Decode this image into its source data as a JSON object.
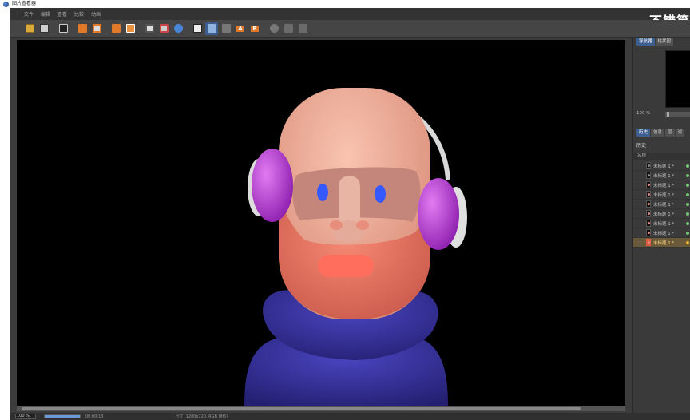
{
  "window": {
    "title": "图片查看器"
  },
  "menubar": {
    "items": [
      "文件",
      "编辑",
      "查看",
      "比较",
      "动画"
    ],
    "banner": "不错算"
  },
  "toolbar": {
    "icons": [
      "open-folder-icon",
      "save-icon",
      "camera-icon",
      "render-region-icon",
      "render-settings-icon",
      "copy-icon",
      "paste-icon",
      "frame-icon",
      "frame-alt-icon",
      "palette-icon",
      "ab-compare-icon",
      "grid-icon",
      "split-icon",
      "a-icon",
      "b-icon",
      "refresh-icon",
      "columns-icon",
      "histogram-icon"
    ],
    "colors": {
      "accent_orange": "#e07a2a",
      "accent_blue": "#3c5f8f"
    }
  },
  "panel": {
    "top_tabs": [
      "导航器",
      "柱状图"
    ],
    "zoom_value": "100 %",
    "bottom_tabs": [
      "历史",
      "信息",
      "层",
      "滤"
    ],
    "history_title": "历史",
    "column_name": "名称",
    "history_rows": [
      {
        "label": "未标题 1 *",
        "thumb": "plain",
        "selected": false
      },
      {
        "label": "未标题 1 *",
        "thumb": "plain",
        "selected": false
      },
      {
        "label": "未标题 1 *",
        "thumb": "face",
        "selected": false
      },
      {
        "label": "未标题 1 *",
        "thumb": "face",
        "selected": false
      },
      {
        "label": "未标题 1 *",
        "thumb": "face",
        "selected": false
      },
      {
        "label": "未标题 1 *",
        "thumb": "face",
        "selected": false
      },
      {
        "label": "未标题 1 *",
        "thumb": "face",
        "selected": false
      },
      {
        "label": "未标题 1 *",
        "thumb": "face",
        "selected": false
      },
      {
        "label": "未标题 1 *",
        "thumb": "face",
        "selected": true
      }
    ]
  },
  "status": {
    "zoom": "100 %",
    "progress": 1.0,
    "time": "00:00:13",
    "info": "尺寸: 1280x720, RGB (8位)"
  },
  "render_subject": {
    "skin": "#f4b09a",
    "beard": "#f07a66",
    "headphone_cup": "#c443d8",
    "sweater": "#3a34a0",
    "eye": "#3658ff"
  }
}
